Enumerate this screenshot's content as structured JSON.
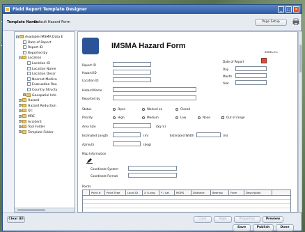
{
  "window": {
    "title": "Field Report Template Designer"
  },
  "toolbar": {
    "template_name_label": "Template Name:",
    "template_name_value": "Default Hazard Form",
    "page_setup_label": "Page Setup",
    "print_icon": "printer-icon"
  },
  "tree": {
    "items": [
      {
        "label": "Available IMSMA Data E",
        "type": "root"
      },
      {
        "label": "Date of Report",
        "type": "leaf"
      },
      {
        "label": "Report ID",
        "type": "leaf"
      },
      {
        "label": "Reported by",
        "type": "leaf"
      },
      {
        "label": "Location",
        "type": "folder"
      },
      {
        "label": "Location ID",
        "type": "leaf"
      },
      {
        "label": "Location Name",
        "type": "leaf"
      },
      {
        "label": "Location Descr",
        "type": "leaf"
      },
      {
        "label": "Nearest Medica",
        "type": "leaf"
      },
      {
        "label": "Evacuation Rou",
        "type": "leaf"
      },
      {
        "label": "Country Structu",
        "type": "leaf"
      },
      {
        "label": "Geospatial Info",
        "type": "folder"
      },
      {
        "label": "Hazard",
        "type": "folder"
      },
      {
        "label": "Hazard Reduction",
        "type": "folder"
      },
      {
        "label": "QC",
        "type": "folder"
      },
      {
        "label": "MRE",
        "type": "folder"
      },
      {
        "label": "Accident",
        "type": "folder"
      },
      {
        "label": "Tool Folder",
        "type": "folder"
      },
      {
        "label": "Template Folder",
        "type": "folder"
      }
    ]
  },
  "form": {
    "title": "IMSMA Hazard Form",
    "code": "IMSMA-H-1",
    "report_id": "Report ID",
    "hazard_id": "Hazard ID",
    "location_id": "Location ID",
    "date_of_report": "Date of Report",
    "day": "Day",
    "month": "Month",
    "year": "Year",
    "hazard_name": "Hazard Name",
    "reported_by": "Reported by",
    "status_label": "Status",
    "status_options": [
      "Open",
      "Worked on",
      "Closed"
    ],
    "priority_label": "Priority",
    "priority_options": [
      "High",
      "Medium",
      "Low",
      "None"
    ],
    "out_of_range": "Out of range",
    "area_size": "Area Size",
    "area_unit": "(Sq m)",
    "estimated_length": "Estimated Length",
    "length_unit": "(m)",
    "estimated_width": "Estimated Width",
    "width_unit": "(m)",
    "azimuth": "Azimuth",
    "azimuth_unit": "(deg)",
    "map_information": "Map Information",
    "coordinate_system": "Coordinate System",
    "coordinate_format": "Coordinate Format",
    "points_label": "Points",
    "points_columns": [
      "Point #",
      "Point Type",
      "Local ID",
      "X / Long",
      "Y / Lat",
      "MGRS",
      "Distance",
      "Bearing",
      "From",
      "Description"
    ]
  },
  "bottom": {
    "clear_all": "Clear All",
    "clear": "Clear",
    "align": "Align",
    "properties": "Properties",
    "preview": "Preview",
    "save": "Save",
    "publish": "Publish",
    "done": "Done"
  },
  "colors": {
    "titlebar": "#2d5aa2",
    "accent": "#2a5496",
    "calendar": "#d94f3a"
  }
}
